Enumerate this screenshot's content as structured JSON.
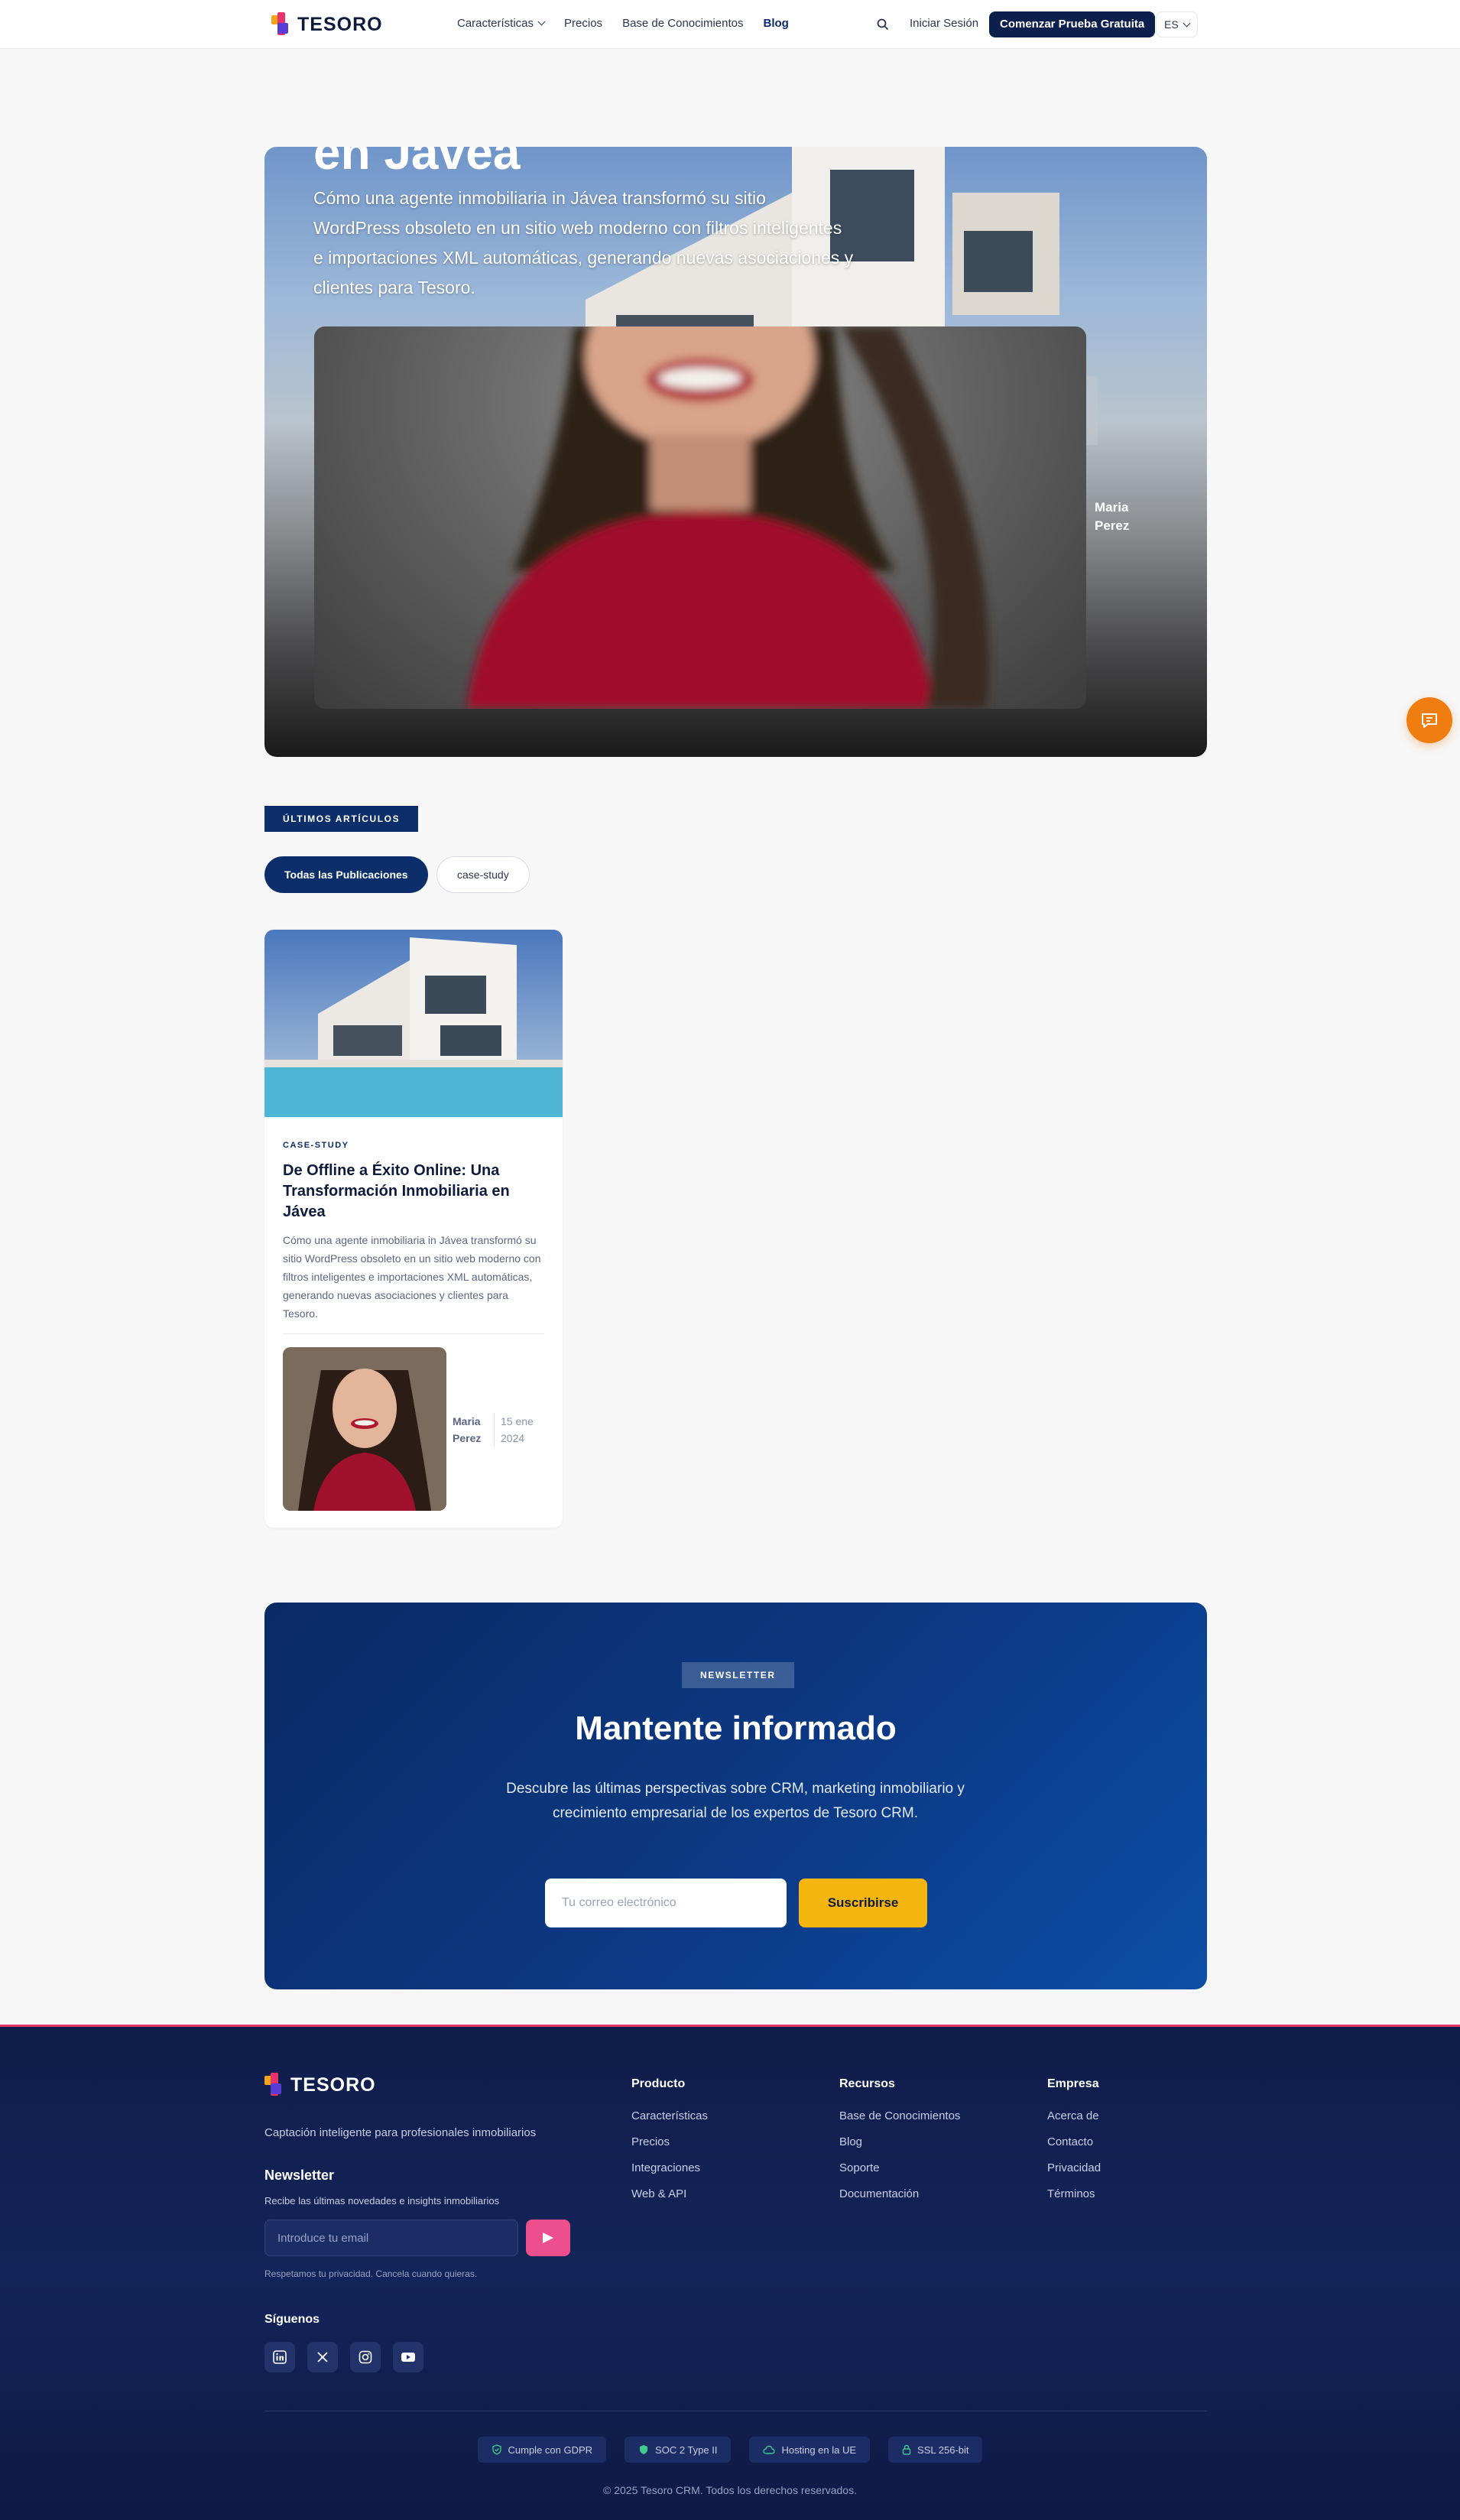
{
  "nav": {
    "logo": "TESORO",
    "links": [
      "Características",
      "Precios",
      "Base de Conocimientos",
      "Blog"
    ],
    "login": "Iniciar Sesión",
    "cta": "Comenzar Prueba Gratuita",
    "lang": "ES"
  },
  "hero": {
    "title": "en Jávea",
    "description": "Cómo una agente inmobiliaria in Jávea transformó su sitio WordPress obsoleto en un sitio web moderno con filtros inteligentes e importaciones XML automáticas, generando nuevas asociaciones y clientes para Tesoro.",
    "author": "Maria Perez"
  },
  "latest": {
    "tag": "ÚLTIMOS ARTÍCULOS",
    "filters": [
      "Todas las Publicaciones",
      "case-study"
    ]
  },
  "card": {
    "tag": "CASE-STUDY",
    "title": "De Offline a Éxito Online: Una Transformación Inmobiliaria en Jávea",
    "description": "Cómo una agente inmobiliaria in Jávea transformó su sitio WordPress obsoleto en un sitio web moderno con filtros inteligentes e importaciones XML automáticas, generando nuevas asociaciones y clientes para Tesoro.",
    "author": "Maria Perez",
    "date": "15 ene 2024"
  },
  "newsletter": {
    "tag": "NEWSLETTER",
    "title": "Mantente informado",
    "description": "Descubre las últimas perspectivas sobre CRM, marketing inmobiliario y crecimiento empresarial de los expertos de Tesoro CRM.",
    "placeholder": "Tu correo electrónico",
    "button": "Suscribirse"
  },
  "footer": {
    "logo": "TESORO",
    "tagline": "Captación inteligente para profesionales inmobiliarios",
    "newsletter_title": "Newsletter",
    "newsletter_sub": "Recibe las últimas novedades e insights inmobiliarios",
    "email_placeholder": "Introduce tu email",
    "privacy": "Respetamos tu privacidad. Cancela cuando quieras.",
    "follow": "Síguenos",
    "socials": [
      "linkedin-icon",
      "x-icon",
      "instagram-icon",
      "youtube-icon"
    ],
    "columns": [
      {
        "title": "Producto",
        "items": [
          "Características",
          "Precios",
          "Integraciones",
          "Web & API"
        ]
      },
      {
        "title": "Recursos",
        "items": [
          "Base de Conocimientos",
          "Blog",
          "Soporte",
          "Documentación"
        ]
      },
      {
        "title": "Empresa",
        "items": [
          "Acerca de",
          "Contacto",
          "Privacidad",
          "Términos"
        ]
      }
    ],
    "badges": [
      "Cumple con GDPR",
      "SOC 2 Type II",
      "Hosting en la UE",
      "SSL 256-bit"
    ],
    "copyright": "© 2025 Tesoro CRM. Todos los derechos reservados."
  },
  "colors": {
    "primary": "#0c2f6b",
    "accent_yellow": "#f5b50f",
    "accent_pink": "#ec4f8c",
    "chat_orange": "#f07d0f"
  }
}
